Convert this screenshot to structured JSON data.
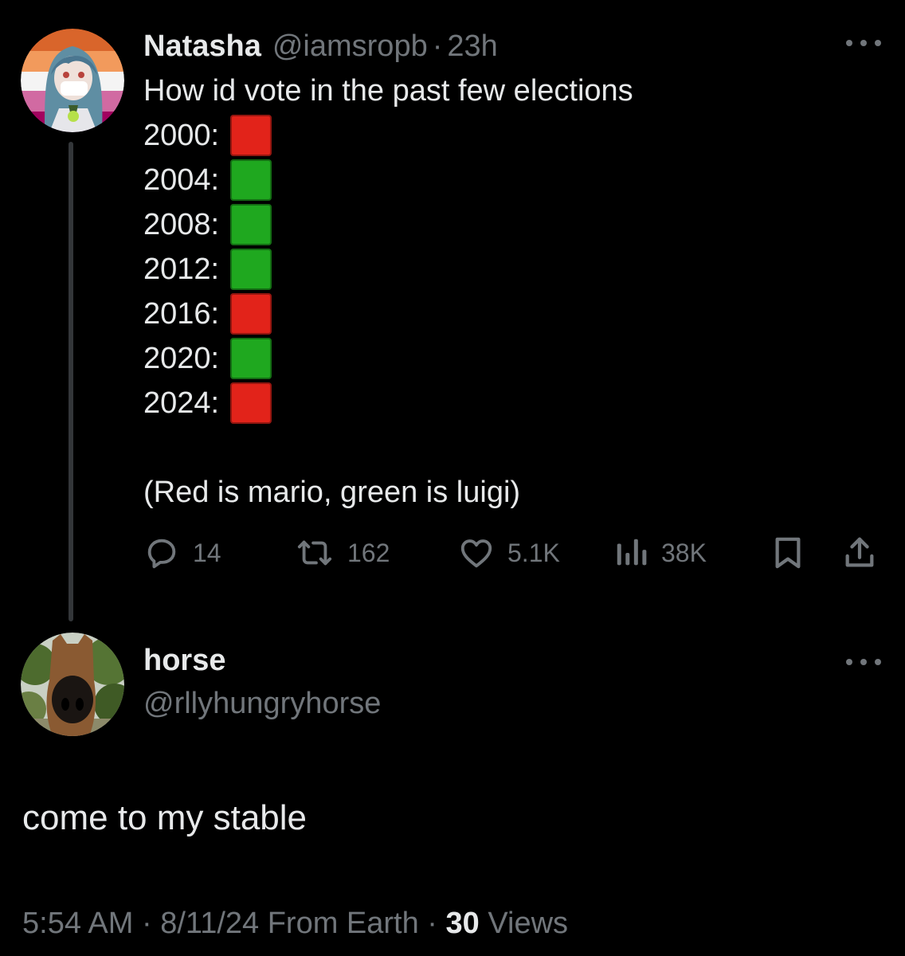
{
  "tweet": {
    "display_name": "Natasha",
    "handle": "@iamsropb",
    "separator": "·",
    "time": "23h",
    "lines": [
      "How id vote in the past few elections"
    ],
    "votes": [
      {
        "year": "2000:",
        "choice": "red"
      },
      {
        "year": "2004:",
        "choice": "green"
      },
      {
        "year": "2008:",
        "choice": "green"
      },
      {
        "year": "2012:",
        "choice": "green"
      },
      {
        "year": "2016:",
        "choice": "red"
      },
      {
        "year": "2020:",
        "choice": "green"
      },
      {
        "year": "2024:",
        "choice": "red"
      }
    ],
    "footnote": "(Red is mario, green is luigi)",
    "actions": {
      "replies": "14",
      "retweets": "162",
      "likes": "5.1K",
      "views": "38K"
    }
  },
  "reply": {
    "display_name": "horse",
    "handle": "@rllyhungryhorse",
    "text": "come to my stable",
    "meta_time": "5:54 AM · 8/11/24 From Earth · ",
    "meta_views_count": "30",
    "meta_views_label": " Views"
  },
  "colors": {
    "red": "#e2231a",
    "green": "#1fa81f",
    "muted": "#71767b",
    "text": "#e7e9ea",
    "background": "#000000"
  },
  "icons": [
    "reply-icon",
    "retweet-icon",
    "like-icon",
    "views-icon",
    "bookmark-icon",
    "share-icon",
    "more-icon"
  ]
}
